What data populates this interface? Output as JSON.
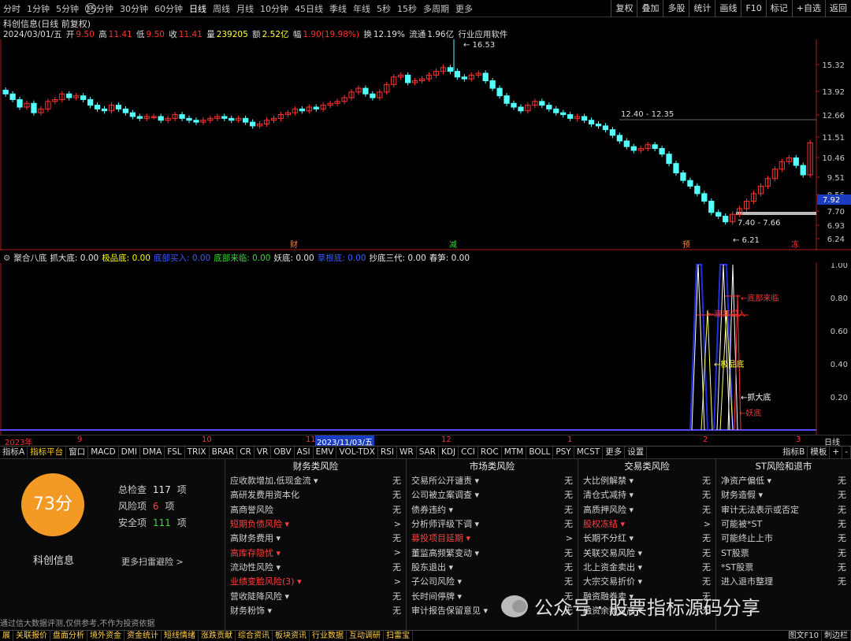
{
  "toolbar": {
    "periods": [
      "分时",
      "1分钟",
      "5分钟",
      "15分钟",
      "30分钟",
      "60分钟",
      "日线",
      "周线",
      "月线",
      "10分钟",
      "45日线",
      "季线",
      "年线",
      "5秒",
      "15秒",
      "多周期",
      "更多"
    ],
    "active_period": "日线",
    "buttons": [
      "复权",
      "叠加",
      "多股",
      "统计",
      "画线",
      "F10",
      "标记",
      "+自选",
      "返回"
    ]
  },
  "stock": {
    "title": "科创信息(日线 前复权)",
    "date": "2024/03/01/五",
    "open_label": "开",
    "open": "9.50",
    "high_label": "高",
    "high": "11.41",
    "low_label": "低",
    "low": "9.50",
    "close_label": "收",
    "close": "11.41",
    "vol_label": "量",
    "vol": "239205",
    "amt_label": "额",
    "amt": "2.52亿",
    "range_label": "幅",
    "range": "1.90(19.98%)",
    "turn_label": "换",
    "turn": "12.19%",
    "float_label": "流通",
    "float": "1.96亿",
    "industry": "行业应用软件"
  },
  "price_axis": [
    "15.32",
    "13.92",
    "12.66",
    "11.51",
    "10.46",
    "9.51",
    "8.56",
    "7.70",
    "6.93",
    "6.24"
  ],
  "price_box": "7.92",
  "annotations": {
    "high": "16.53",
    "low": "6.21",
    "range1": "12.40 - 12.35",
    "range2": "7.40 - 7.66"
  },
  "event_tags": [
    "财",
    "减",
    "预",
    "冻"
  ],
  "indicator": {
    "name": "聚合八底",
    "fields": [
      {
        "k": "抓大底",
        "v": "0.00",
        "c": "#e8e8e8"
      },
      {
        "k": "极品底",
        "v": "0.00",
        "c": "#ffff00"
      },
      {
        "k": "底部买入",
        "v": "0.00",
        "c": "#3b5bff"
      },
      {
        "k": "底部来临",
        "v": "0.00",
        "c": "#33dd33"
      },
      {
        "k": "妖底",
        "v": "0.00",
        "c": "#e8e8e8"
      },
      {
        "k": "草根底",
        "v": "0.00",
        "c": "#3b5bff"
      },
      {
        "k": "抄底三代",
        "v": "0.00",
        "c": "#e8e8e8"
      },
      {
        "k": "春笋",
        "v": "0.00",
        "c": "#e8e8e8"
      }
    ],
    "axis": [
      "1.00",
      "0.80",
      "0.60",
      "0.40",
      "0.20"
    ],
    "labels": [
      "底部来临",
      "底部买入",
      "极品底",
      "抓大底",
      "妖底"
    ]
  },
  "dates": {
    "y2023": "2023年",
    "m9": "9",
    "m10": "10",
    "m11": "11",
    "cursor": "2023/11/03/五",
    "m12": "12",
    "m1": "1",
    "m2": "2",
    "m3": "3",
    "right": "日线"
  },
  "tabs": [
    "指标A",
    "指标平台",
    "窗口",
    "MACD",
    "DMI",
    "DMA",
    "FSL",
    "TRIX",
    "BRAR",
    "CR",
    "VR",
    "OBV",
    "ASI",
    "EMV",
    "VOL-TDX",
    "RSI",
    "WR",
    "SAR",
    "KDJ",
    "CCI",
    "ROC",
    "MTM",
    "BOLL",
    "PSY",
    "MCST",
    "更多",
    "设置"
  ],
  "tabs_right": [
    "指标B",
    "模板",
    "+",
    "-"
  ],
  "risk": {
    "score": "73分",
    "company": "科创信息",
    "total_label": "总检查",
    "total": "117",
    "unit": "项",
    "risk_label": "风险项",
    "risk_count": "6",
    "safe_label": "安全项",
    "safe": "111",
    "more": "更多扫雷避险 >",
    "disclaimer": "通过信大数据评测,仅供参考,不作为投资依据",
    "cols": [
      {
        "title": "财务类风险",
        "rows": [
          {
            "k": "应收款增加,低现金流 ▾",
            "v": "无",
            "r": false
          },
          {
            "k": "高研发费用资本化",
            "v": "无",
            "r": false
          },
          {
            "k": "高商誉风险",
            "v": "无",
            "r": false
          },
          {
            "k": "短期负债风险 ▾",
            "v": ">",
            "r": true
          },
          {
            "k": "高财务费用 ▾",
            "v": "无",
            "r": false
          },
          {
            "k": "高库存隐忧 ▾",
            "v": ">",
            "r": true
          },
          {
            "k": "流动性风险 ▾",
            "v": "无",
            "r": false
          },
          {
            "k": "业绩变脸风险(3) ▾",
            "v": ">",
            "r": true
          },
          {
            "k": "营收陡降风险 ▾",
            "v": "无",
            "r": false
          },
          {
            "k": "财务粉饰 ▾",
            "v": "无",
            "r": false
          }
        ]
      },
      {
        "title": "市场类风险",
        "rows": [
          {
            "k": "交易所公开谴责 ▾",
            "v": "无",
            "r": false
          },
          {
            "k": "公司被立案调查 ▾",
            "v": "无",
            "r": false
          },
          {
            "k": "债券违约 ▾",
            "v": "无",
            "r": false
          },
          {
            "k": "分析师评级下调 ▾",
            "v": "无",
            "r": false
          },
          {
            "k": "募投项目延期 ▾",
            "v": ">",
            "r": true
          },
          {
            "k": "董监高频繁变动 ▾",
            "v": "无",
            "r": false
          },
          {
            "k": "股东退出 ▾",
            "v": "无",
            "r": false
          },
          {
            "k": "子公司风险 ▾",
            "v": "无",
            "r": false
          },
          {
            "k": "长时间停牌 ▾",
            "v": "无",
            "r": false
          },
          {
            "k": "审计报告保留意见 ▾",
            "v": "无",
            "r": false
          }
        ]
      },
      {
        "title": "交易类风险",
        "rows": [
          {
            "k": "大比例解禁 ▾",
            "v": "无",
            "r": false
          },
          {
            "k": "清仓式减持 ▾",
            "v": "无",
            "r": false
          },
          {
            "k": "高质押风险 ▾",
            "v": "无",
            "r": false
          },
          {
            "k": "股权冻结 ▾",
            "v": ">",
            "r": true
          },
          {
            "k": "长期不分红 ▾",
            "v": "无",
            "r": false
          },
          {
            "k": "关联交易风险 ▾",
            "v": "无",
            "r": false
          },
          {
            "k": "北上资金卖出 ▾",
            "v": "无",
            "r": false
          },
          {
            "k": "大宗交易折价 ▾",
            "v": "无",
            "r": false
          },
          {
            "k": "融资融券卖 ▾",
            "v": "无",
            "r": false
          },
          {
            "k": "融资余额过高 ▾",
            "v": "无",
            "r": false
          }
        ]
      },
      {
        "title": "ST风险和退市",
        "rows": [
          {
            "k": "净资产偏低 ▾",
            "v": "无",
            "r": false
          },
          {
            "k": "财务造假 ▾",
            "v": "无",
            "r": false
          },
          {
            "k": "审计无法表示或否定",
            "v": "无",
            "r": false
          },
          {
            "k": "可能被*ST",
            "v": "无",
            "r": false
          },
          {
            "k": "可能终止上市",
            "v": "无",
            "r": false
          },
          {
            "k": "ST股票",
            "v": "无",
            "r": false
          },
          {
            "k": "*ST股票",
            "v": "无",
            "r": false
          },
          {
            "k": "进入退市整理",
            "v": "无",
            "r": false
          }
        ]
      }
    ]
  },
  "bottom": [
    "展",
    "关联报价",
    "盘面分析",
    "境外资金",
    "资金统计",
    "短线情绪",
    "涨跌贡献",
    "综合资讯",
    "板块资讯",
    "行业数据",
    "互动调研",
    "扫雷宝"
  ],
  "bottom_right": [
    "图文F10",
    "刺边栏"
  ],
  "watermark": "公众号 · 股票指标源码分享",
  "colors": {
    "up": "#ff3232",
    "down": "#54ffff",
    "bg": "#000000",
    "accent": "#f29a23"
  }
}
